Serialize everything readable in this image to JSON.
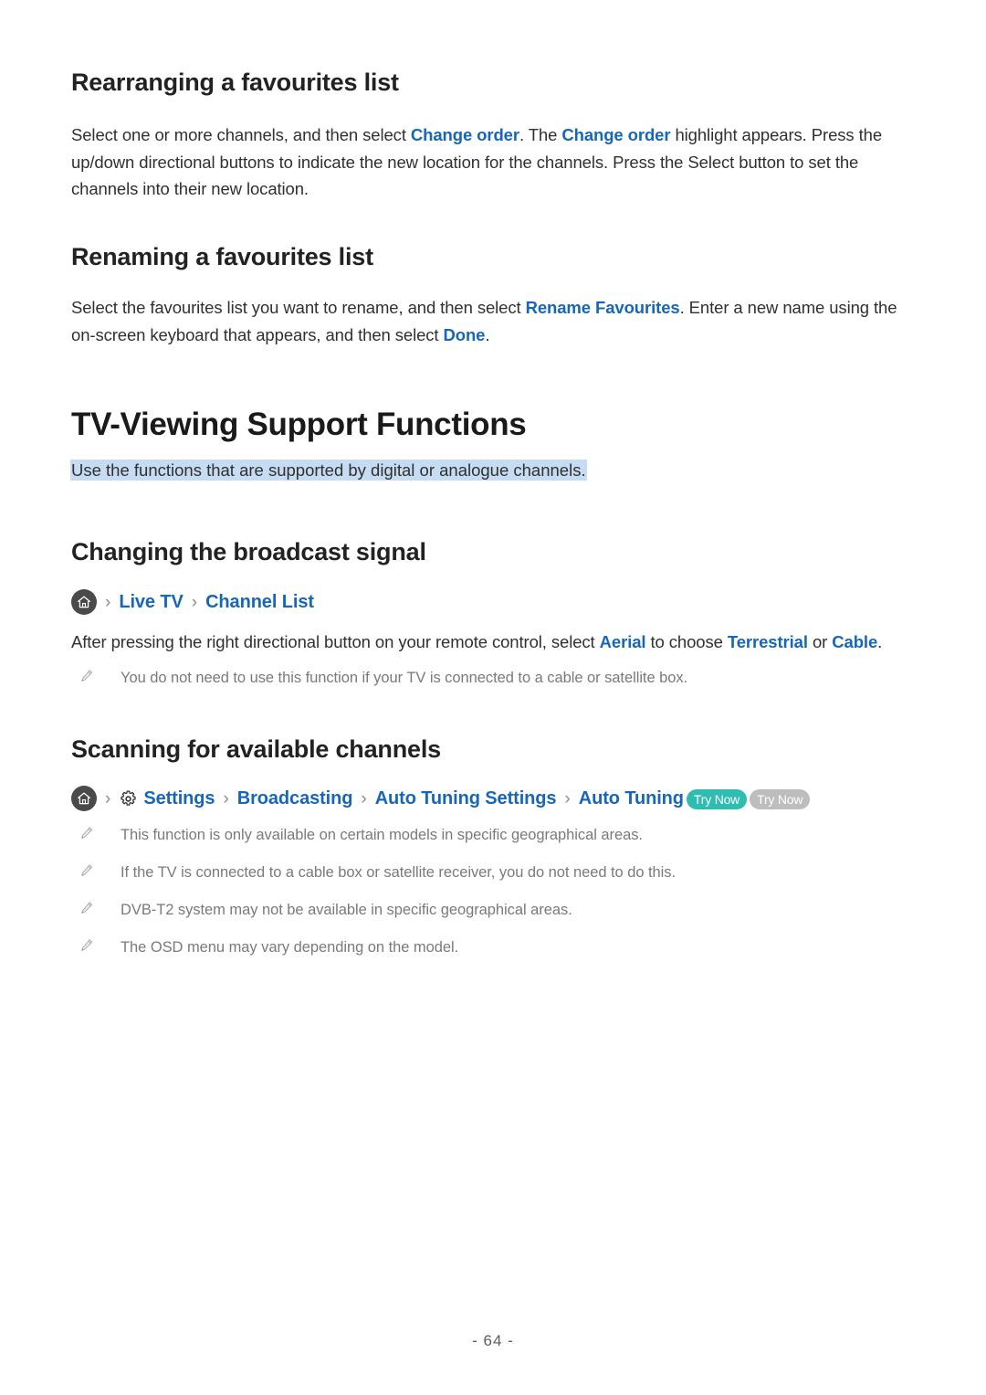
{
  "sections": {
    "rearranging": {
      "heading": "Rearranging a favourites list",
      "para": {
        "t1": "Select one or more channels, and then select ",
        "link1": "Change order",
        "t2": ". The ",
        "link2": "Change order",
        "t3": " highlight appears. Press the up/down directional buttons to indicate the new location for the channels. Press the Select button to set the channels into their new location."
      }
    },
    "renaming": {
      "heading": "Renaming a favourites list",
      "para": {
        "t1": "Select the favourites list you want to rename, and then select ",
        "link1": "Rename Favourites",
        "t2": ". Enter a new name using the on-screen keyboard that appears, and then select ",
        "link2": "Done",
        "t3": "."
      }
    },
    "tv_viewing": {
      "heading": "TV-Viewing Support Functions",
      "highlight": "Use the functions that are supported by digital or analogue channels."
    },
    "changing_signal": {
      "heading": "Changing the broadcast signal",
      "breadcrumb": {
        "home_icon": "home-icon",
        "separator": "›",
        "items": [
          {
            "label": "Live TV"
          },
          {
            "label": "Channel List"
          }
        ]
      },
      "para": {
        "t1": "After pressing the right directional button on your remote control, select ",
        "link1": "Aerial",
        "t2": " to choose ",
        "link2": "Terrestrial",
        "t3": " or ",
        "link3": "Cable",
        "t4": "."
      },
      "notes": [
        {
          "icon": "pencil-icon",
          "text": "You do not need to use this function if your TV is connected to a cable or satellite box."
        }
      ]
    },
    "scanning": {
      "heading": "Scanning for available channels",
      "breadcrumb": {
        "home_icon": "home-icon",
        "gear_icon": "gear-icon",
        "separator": "›",
        "items": [
          {
            "label": "Settings",
            "icon": "gear-icon"
          },
          {
            "label": "Broadcasting"
          },
          {
            "label": "Auto Tuning Settings"
          },
          {
            "label": "Auto Tuning"
          }
        ],
        "badges": [
          {
            "label": "Try Now",
            "style": "teal",
            "color": "#2fbdb2"
          },
          {
            "label": "Try Now",
            "style": "grey",
            "color": "#bdbdbd"
          }
        ]
      },
      "notes": [
        {
          "icon": "pencil-icon",
          "text": "This function is only available on certain models in specific geographical areas."
        },
        {
          "icon": "pencil-icon",
          "text": "If the TV is connected to a cable box or satellite receiver, you do not need to do this."
        },
        {
          "icon": "pencil-icon",
          "text": "DVB-T2 system may not be available in specific geographical areas."
        },
        {
          "icon": "pencil-icon",
          "text": "The OSD menu may vary depending on the model."
        }
      ]
    }
  },
  "footer": {
    "page_number": "- 64 -"
  },
  "colors": {
    "link": "#1767b8",
    "highlight_bg": "#c6dcf2",
    "note_text": "#7a7a7a",
    "badge_teal": "#2fbdb2",
    "badge_grey": "#bdbdbd",
    "home_circle": "#4a4a4a"
  }
}
